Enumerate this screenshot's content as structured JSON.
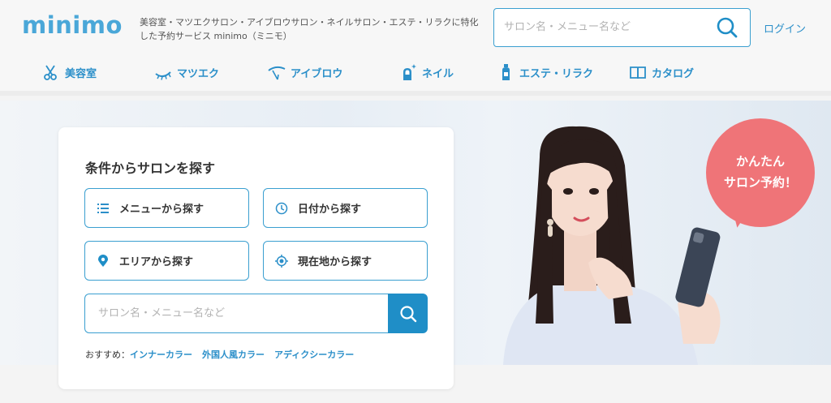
{
  "header": {
    "logo": "minimo",
    "tagline": "美容室・マツエクサロン・アイブロウサロン・ネイルサロン・エステ・リラクに特化した予約サービス minimo（ミニモ）",
    "search_placeholder": "サロン名・メニュー名など",
    "login": "ログイン"
  },
  "nav": [
    {
      "label": "美容室",
      "icon": "scissors-icon"
    },
    {
      "label": "マツエク",
      "icon": "eyelash-icon"
    },
    {
      "label": "アイブロウ",
      "icon": "eyebrow-icon"
    },
    {
      "label": "ネイル",
      "icon": "nail-icon"
    },
    {
      "label": "エステ・リラク",
      "icon": "bottle-icon"
    },
    {
      "label": "カタログ",
      "icon": "book-icon"
    }
  ],
  "search_card": {
    "title": "条件からサロンを探す",
    "options": [
      {
        "label": "メニューから探す",
        "icon": "list-icon"
      },
      {
        "label": "日付から探す",
        "icon": "clock-icon"
      },
      {
        "label": "エリアから探す",
        "icon": "map-pin-icon"
      },
      {
        "label": "現在地から探す",
        "icon": "location-target-icon"
      }
    ],
    "search_placeholder": "サロン名・メニュー名など",
    "recommend_label": "おすすめ：",
    "recommend_links": [
      "インナーカラー",
      "外国人風カラー",
      "アディクシーカラー"
    ]
  },
  "hero": {
    "bubble_line1": "かんたん",
    "bubble_line2": "サロン予約！"
  },
  "colors": {
    "brand": "#4aa7d8",
    "link": "#2b8fc9",
    "button": "#1f8ec7",
    "bubble": "#ef7478"
  }
}
